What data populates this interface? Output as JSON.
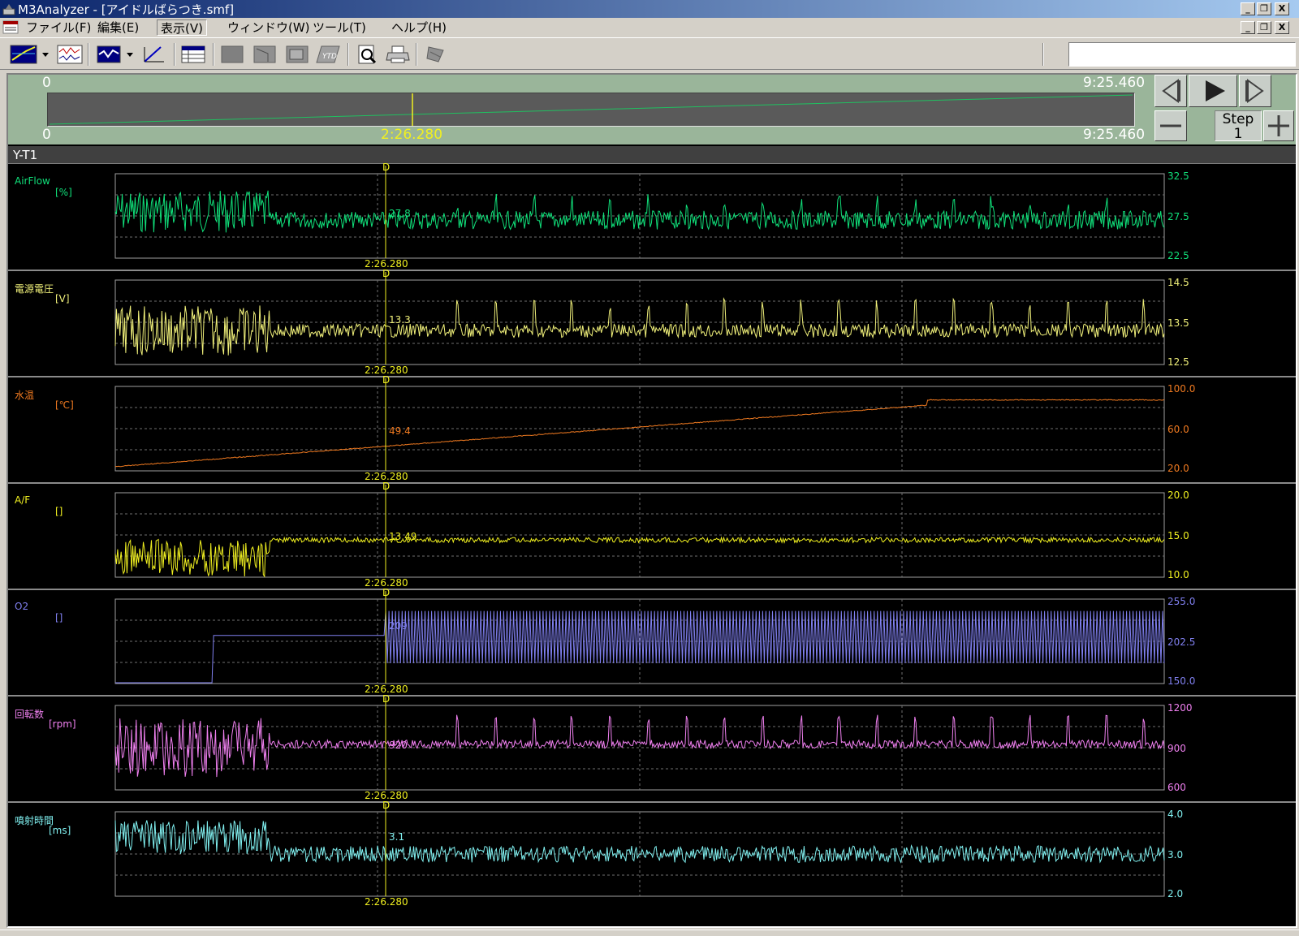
{
  "window": {
    "title": "M3Analyzer - [アイドルばらつき.smf]",
    "buttons": {
      "minimize": "_",
      "restore": "❐",
      "close": "X"
    }
  },
  "menu": {
    "items": [
      {
        "label": "ファイル(F)"
      },
      {
        "label": "編集(E)"
      },
      {
        "label": "表示(V)"
      },
      {
        "label": "ウィンドウ(W)"
      },
      {
        "label": "ツール(T)"
      },
      {
        "label": "ヘルプ(H)"
      }
    ]
  },
  "timeline": {
    "start_top": "0",
    "end_top": "9:25.460",
    "start_bottom": "0",
    "end_bottom": "9:25.460",
    "cursor_time": "2:26.280",
    "cursor_fraction": 0.258,
    "step_label": "Step",
    "step_value": "1"
  },
  "pane_title": "Y-T1",
  "cursor": {
    "time_label": "2:26.280",
    "marker": "D"
  },
  "channels": [
    {
      "name": "AirFlow",
      "unit": "[%]",
      "color": "#10e07a",
      "ticks": [
        "32.5",
        "27.5",
        "22.5"
      ],
      "cursor_value": "27.8",
      "min": 22.5,
      "max": 32.5
    },
    {
      "name": "電源電圧",
      "unit": "[V]",
      "color": "#f0f07a",
      "ticks": [
        "14.5",
        "13.5",
        "12.5"
      ],
      "cursor_value": "13.3",
      "min": 12.5,
      "max": 14.5
    },
    {
      "name": "水温",
      "unit": "[℃]",
      "color": "#f07a20",
      "ticks": [
        "100.0",
        "60.0",
        "20.0"
      ],
      "cursor_value": "49.4",
      "min": 20.0,
      "max": 100.0
    },
    {
      "name": "A/F",
      "unit": "[]",
      "color": "#f0f020",
      "ticks": [
        "20.0",
        "15.0",
        "10.0"
      ],
      "cursor_value": "13.49",
      "min": 10.0,
      "max": 20.0
    },
    {
      "name": "O2",
      "unit": "[]",
      "color": "#8080f0",
      "ticks": [
        "255.0",
        "202.5",
        "150.0"
      ],
      "cursor_value": "209",
      "min": 150.0,
      "max": 255.0
    },
    {
      "name": "回転数",
      "unit": "[rpm]",
      "color": "#f080f0",
      "ticks": [
        "1200",
        "900",
        "600"
      ],
      "cursor_value": "920",
      "min": 600,
      "max": 1200
    },
    {
      "name": "噴射時間",
      "unit": "[ms]",
      "color": "#80f0f0",
      "ticks": [
        "4.0",
        "3.0",
        "2.0"
      ],
      "cursor_value": "3.1",
      "min": 2.0,
      "max": 4.0
    }
  ]
}
